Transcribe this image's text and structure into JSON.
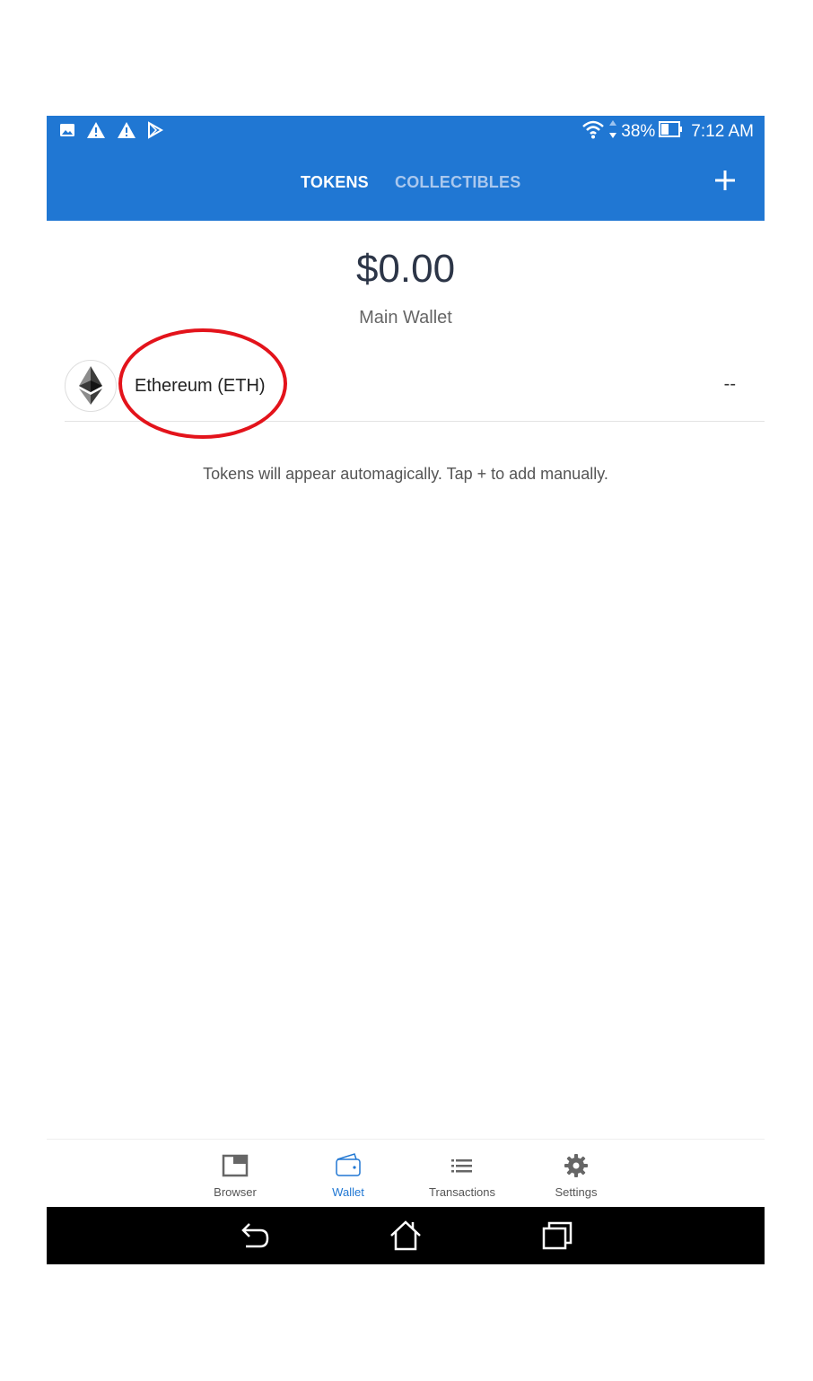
{
  "status_bar": {
    "battery_percent": "38%",
    "time": "7:12 AM",
    "left_icons": [
      "image-icon",
      "warning-icon",
      "warning-icon",
      "play-store-icon"
    ],
    "right_icons": [
      "wifi-icon",
      "data-arrows-icon",
      "battery-icon"
    ]
  },
  "app_bar": {
    "tabs": [
      {
        "label": "TOKENS",
        "active": true
      },
      {
        "label": "COLLECTIBLES",
        "active": false
      }
    ],
    "add_icon": "plus-icon",
    "color": "#2077d3"
  },
  "wallet": {
    "balance": "$0.00",
    "name": "Main Wallet"
  },
  "tokens": [
    {
      "name": "Ethereum (ETH)",
      "balance": "--",
      "icon": "ethereum-icon"
    }
  ],
  "hint": "Tokens will appear automagically. Tap + to add manually.",
  "bottom_nav": [
    {
      "label": "Browser",
      "icon": "browser-icon",
      "active": false
    },
    {
      "label": "Wallet",
      "icon": "wallet-icon",
      "active": true
    },
    {
      "label": "Transactions",
      "icon": "list-icon",
      "active": false
    },
    {
      "label": "Settings",
      "icon": "gear-icon",
      "active": false
    }
  ],
  "system_nav": [
    "back-icon",
    "home-icon",
    "recents-icon"
  ],
  "annotation_color": "#e3131b"
}
